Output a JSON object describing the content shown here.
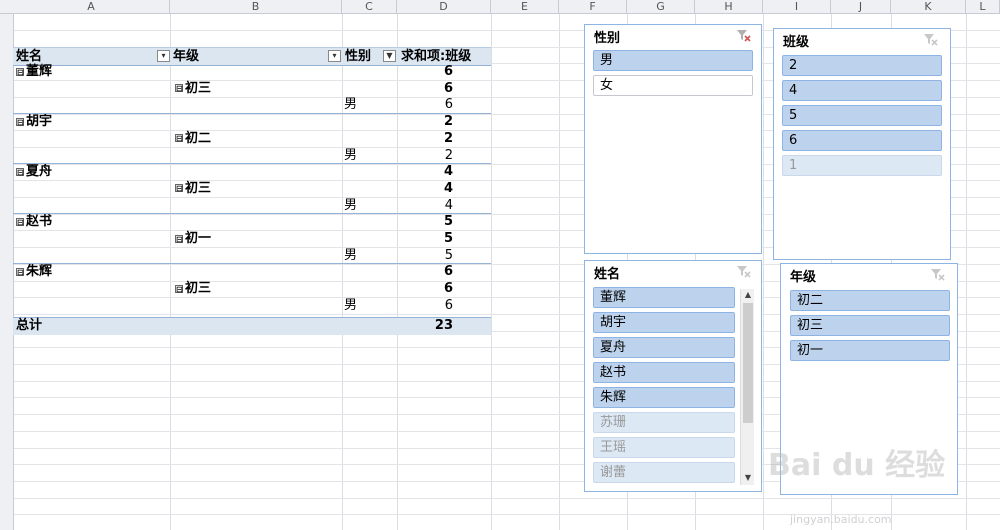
{
  "columns": [
    "A",
    "B",
    "C",
    "D",
    "E",
    "F",
    "G",
    "H",
    "I",
    "J",
    "K",
    "L"
  ],
  "rows": [
    "",
    "",
    "",
    "",
    "",
    "",
    "",
    "",
    "",
    "",
    "",
    "",
    "",
    "",
    "",
    "",
    "",
    "",
    "",
    "",
    "",
    "",
    "",
    "",
    "",
    "",
    "",
    "",
    "",
    "",
    ""
  ],
  "pivot": {
    "headers": {
      "name": "姓名",
      "grade": "年级",
      "gender": "性别",
      "sum": "求和项:班级"
    },
    "collapse_glyph": "⊟",
    "dropdown_glyph": "▾",
    "filter_glyph": "▼",
    "groups": [
      {
        "name": "董辉",
        "name_total": "6",
        "grade": "初三",
        "grade_total": "6",
        "gender": "男",
        "value": "6"
      },
      {
        "name": "胡宇",
        "name_total": "2",
        "grade": "初二",
        "grade_total": "2",
        "gender": "男",
        "value": "2"
      },
      {
        "name": "夏舟",
        "name_total": "4",
        "grade": "初三",
        "grade_total": "4",
        "gender": "男",
        "value": "4"
      },
      {
        "name": "赵书",
        "name_total": "5",
        "grade": "初一",
        "grade_total": "5",
        "gender": "男",
        "value": "5"
      },
      {
        "name": "朱辉",
        "name_total": "6",
        "grade": "初三",
        "grade_total": "6",
        "gender": "男",
        "value": "6"
      }
    ],
    "total_label": "总计",
    "total_value": "23"
  },
  "slicers": {
    "gender": {
      "title": "性别",
      "items": [
        {
          "label": "男",
          "state": "selected"
        },
        {
          "label": "女",
          "state": "unselected"
        }
      ]
    },
    "class": {
      "title": "班级",
      "items": [
        {
          "label": "2",
          "state": "selected"
        },
        {
          "label": "4",
          "state": "selected"
        },
        {
          "label": "5",
          "state": "selected"
        },
        {
          "label": "6",
          "state": "selected"
        },
        {
          "label": "1",
          "state": "nodata"
        }
      ]
    },
    "name": {
      "title": "姓名",
      "items": [
        {
          "label": "董辉",
          "state": "selected"
        },
        {
          "label": "胡宇",
          "state": "selected"
        },
        {
          "label": "夏舟",
          "state": "selected"
        },
        {
          "label": "赵书",
          "state": "selected"
        },
        {
          "label": "朱辉",
          "state": "selected"
        },
        {
          "label": "苏珊",
          "state": "nodata"
        },
        {
          "label": "王瑶",
          "state": "nodata"
        },
        {
          "label": "谢蕾",
          "state": "nodata"
        }
      ],
      "scroll_up": "▲",
      "scroll_down": "▼"
    },
    "grade": {
      "title": "年级",
      "items": [
        {
          "label": "初二",
          "state": "selected"
        },
        {
          "label": "初三",
          "state": "selected"
        },
        {
          "label": "初一",
          "state": "selected"
        }
      ]
    }
  },
  "colors": {
    "header_fill": "#dce6f1",
    "slicer_border": "#8eb4e3",
    "slicer_selected": "#bdd3ed"
  },
  "watermark": {
    "text": "Bai du 经验",
    "url": "jingyan.baidu.com"
  }
}
